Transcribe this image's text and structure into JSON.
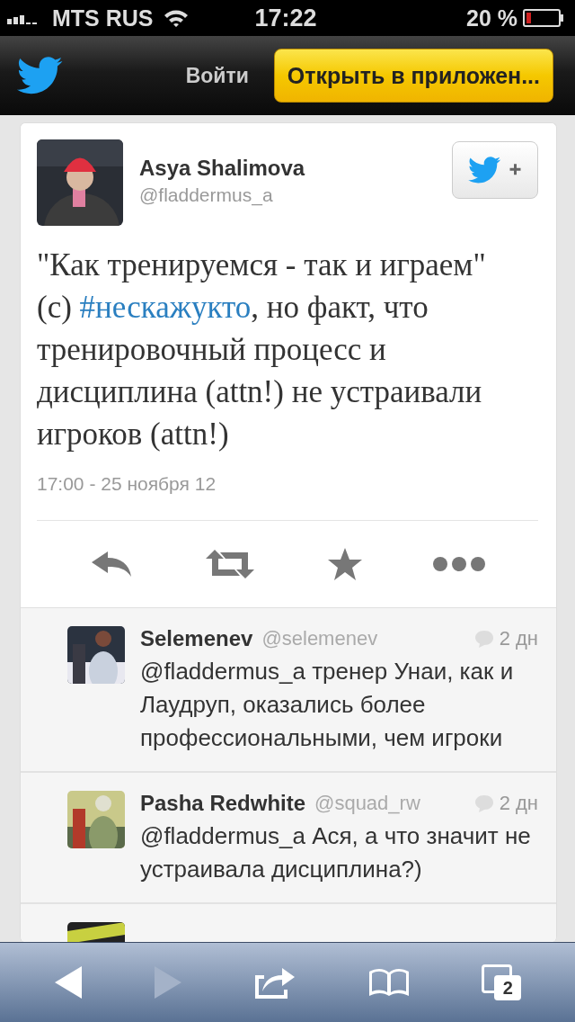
{
  "status_bar": {
    "carrier": "MTS RUS",
    "time": "17:22",
    "battery": "20 %"
  },
  "nav": {
    "login": "Войти",
    "open_app": "Открыть в приложен..."
  },
  "tweet": {
    "name": "Asya Shalimova",
    "handle": "@fladdermus_a",
    "text": [
      {
        "kind": "text",
        "text": "\"Как тренируемся - так и играем\" (с) "
      },
      {
        "kind": "hashtag",
        "text": "#нескажукто"
      },
      {
        "kind": "text",
        "text": ", но факт, что тренировочный процесс и дисциплина (attn!) не устраивали игроков (attn!)"
      }
    ],
    "timestamp": "17:00 - 25 ноября 12"
  },
  "replies": [
    {
      "name": "Selemenev",
      "handle": "@selemenev",
      "age": "2 дн",
      "text": "@fladdermus_a тренер Унаи, как и Лаудруп, оказались более профессиональными, чем игроки"
    },
    {
      "name": "Pasha Redwhite",
      "handle": "@squad_rw",
      "age": "2 дн",
      "text": "@fladdermus_a Ася, а что значит не устраивала дисциплина?)"
    }
  ],
  "toolbar": {
    "back_disabled": false,
    "forward_disabled": true,
    "tabs_count": "2"
  }
}
